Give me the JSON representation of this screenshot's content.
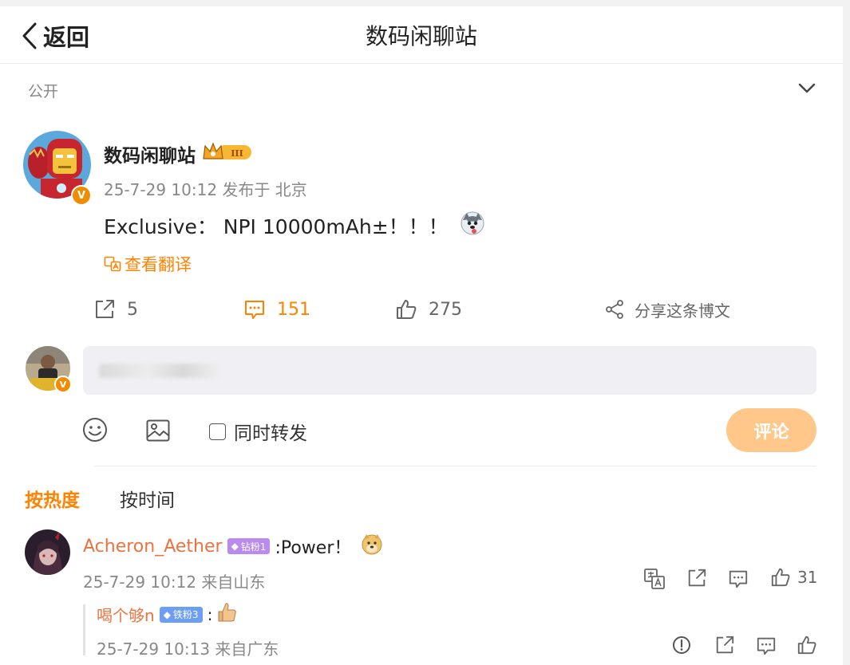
{
  "header": {
    "back_label": "返回",
    "title": "数码闲聊站"
  },
  "visibility": "公开",
  "post": {
    "author": "数码闲聊站",
    "timestamp": "25-7-29 10:12 发布于 北京",
    "content": "Exclusive： NPI 10000mAh±！！！",
    "translate_label": "查看翻译",
    "verified_badge": "V",
    "crown_level": "III",
    "actions": {
      "repost_count": "5",
      "comment_count": "151",
      "like_count": "275",
      "share_label": "分享这条博文"
    }
  },
  "composer": {
    "repost_label": "同时转发",
    "submit_label": "评论"
  },
  "sort": {
    "hot": "按热度",
    "time": "按时间"
  },
  "comments": [
    {
      "user": "Acheron_Aether",
      "fan_badge": "钻粉1",
      "text": ":Power！",
      "meta": "25-7-29 10:12 来自山东",
      "like_count": "31",
      "replies": [
        {
          "user": "喝个够n",
          "fan_badge": "铁粉3",
          "text": ":",
          "meta": "25-7-29 10:13 来自广东"
        }
      ]
    }
  ],
  "colors": {
    "accent": "#ff8200",
    "submit_disabled": "#ffc88a",
    "username": "#eb7340"
  }
}
